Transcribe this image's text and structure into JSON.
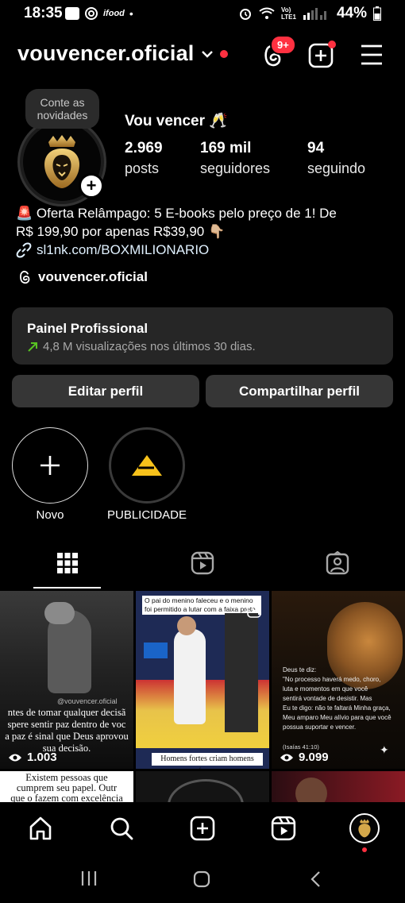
{
  "status_bar": {
    "time": "18:35",
    "network_label": "Vo) LTE1",
    "battery": "44%"
  },
  "header": {
    "username": "vouvencer.oficial",
    "threads_badge": "9+"
  },
  "profile": {
    "bubble_text": "Conte as novidades",
    "display_name": "Vou vencer 🥂",
    "stats": [
      {
        "value": "2.969",
        "label": "posts"
      },
      {
        "value": "169 mil",
        "label": "seguidores"
      },
      {
        "value": "94",
        "label": "seguindo"
      }
    ],
    "bio_line1": "🚨 Oferta Relâmpago: 5 E-books pelo preço de 1! De",
    "bio_line2": "R$ 199,90 por apenas R$39,90 👇🏼",
    "link": "sl1nk.com/BOXMILIONARIO",
    "threads_handle": "vouvencer.oficial"
  },
  "panel": {
    "title": "Painel Profissional",
    "subtitle": "4,8 M visualizações nos últimos 30 dias."
  },
  "buttons": {
    "edit": "Editar perfil",
    "share": "Compartilhar perfil"
  },
  "highlights": [
    {
      "label": "Novo"
    },
    {
      "label": "PUBLICIDADE"
    }
  ],
  "grid": {
    "post1": {
      "watermark": "@vouvencer.oficial",
      "text1": "ntes de tomar qualquer decisã",
      "text2": "spere sentir paz dentro de voc",
      "text3": "a paz é sinal que Deus aprovou",
      "text4": "sua decisão.",
      "views": "1.003"
    },
    "post2": {
      "top_text": "O pai do menino faleceu e o menino foi permitido a lutar com a faixa preta do pai",
      "bottom_text": "Homens fortes criam homens fortes"
    },
    "post3": {
      "l1": "Deus te diz:",
      "l2": "\"No processo haverá medo, choro,",
      "l3": "luta e momentos em que você",
      "l4": "sentirá vontade de desistir. Mas",
      "l5": "Eu te digo: não te faltará Minha graça,",
      "l6": "Meu amparo Meu alívio para que você",
      "l7": "possua suportar e vencer.",
      "ref": "(Isaías 41:10)",
      "views": "9.099"
    },
    "post4": {
      "l1": "Existem pessoas que",
      "l2": "cumprem seu papel. Outr",
      "l3": "que o fazem com excelência"
    }
  },
  "colors": {
    "accent_red": "#ff3040",
    "panel_bg": "#262626",
    "button_bg": "#363636",
    "link": "#e0f1ff",
    "growth_green": "#58c322"
  }
}
